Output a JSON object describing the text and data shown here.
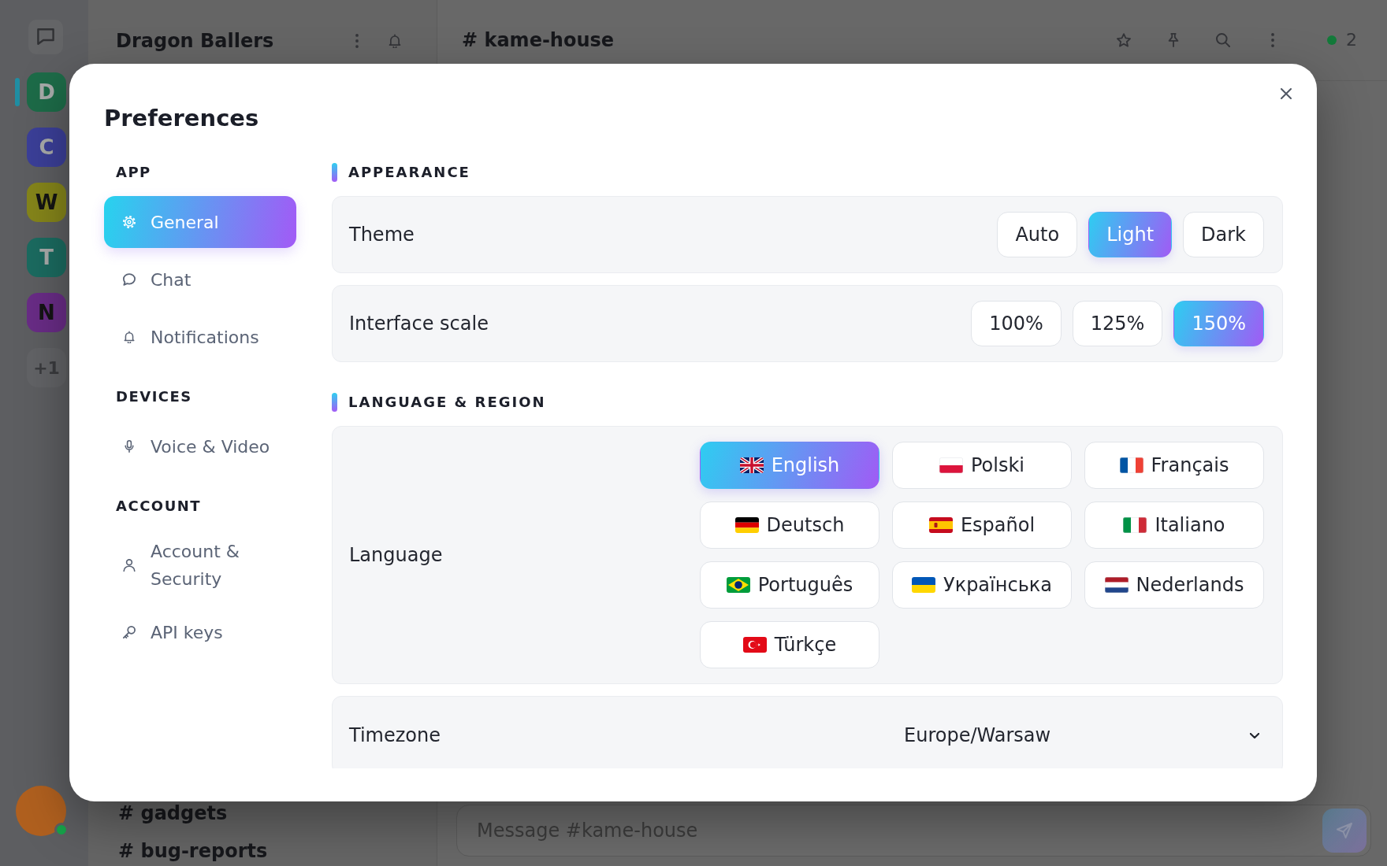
{
  "app": {
    "rail": {
      "servers": [
        {
          "letter": "D",
          "color": "#1d6b48",
          "selected": true
        },
        {
          "letter": "C",
          "color": "#3b3f98",
          "selected": false
        },
        {
          "letter": "W",
          "color": "#85851a",
          "selected": false
        },
        {
          "letter": "T",
          "color": "#1b6b60",
          "selected": false
        },
        {
          "letter": "N",
          "color": "#692c86",
          "selected": false
        }
      ],
      "more": "+1"
    },
    "sidebar": {
      "title": "Dragon Ballers",
      "channels": [
        {
          "label": "# gadgets"
        },
        {
          "label": "# bug-reports"
        }
      ]
    },
    "channel": {
      "title": "# kame-house",
      "online_count": "2",
      "composer": {
        "placeholder": "Message #kame-house"
      }
    }
  },
  "dialog": {
    "title": "Preferences",
    "nav": [
      {
        "heading": "APP",
        "items": [
          {
            "label": "General",
            "selected": true
          },
          {
            "label": "Chat",
            "selected": false
          },
          {
            "label": "Notifications",
            "selected": false
          }
        ]
      },
      {
        "heading": "DEVICES",
        "items": [
          {
            "label": "Voice & Video",
            "selected": false
          }
        ]
      },
      {
        "heading": "ACCOUNT",
        "items": [
          {
            "label": "Account & Security",
            "selected": false
          },
          {
            "label": "API keys",
            "selected": false
          }
        ]
      }
    ],
    "sections": [
      {
        "heading": "APPEARANCE",
        "rows": [
          {
            "kind": "segmented",
            "label": "Theme",
            "options": [
              {
                "label": "Auto",
                "selected": false
              },
              {
                "label": "Light",
                "selected": true
              },
              {
                "label": "Dark",
                "selected": false
              }
            ]
          },
          {
            "kind": "segmented",
            "label": "Interface scale",
            "options": [
              {
                "label": "100%",
                "selected": false
              },
              {
                "label": "125%",
                "selected": false
              },
              {
                "label": "150%",
                "selected": true
              }
            ]
          }
        ]
      },
      {
        "heading": "LANGUAGE & REGION",
        "rows": [
          {
            "kind": "grid",
            "label": "Language",
            "options": [
              {
                "label": "English",
                "selected": true
              },
              {
                "label": "Polski",
                "selected": false
              },
              {
                "label": "Français",
                "selected": false
              },
              {
                "label": "Deutsch",
                "selected": false
              },
              {
                "label": "Español",
                "selected": false
              },
              {
                "label": "Italiano",
                "selected": false
              },
              {
                "label": "Português",
                "selected": false
              },
              {
                "label": "Українська",
                "selected": false
              },
              {
                "label": "Nederlands",
                "selected": false
              },
              {
                "label": "Türkçe",
                "selected": false
              }
            ]
          },
          {
            "kind": "select",
            "label": "Timezone",
            "value": "Europe/Warsaw"
          }
        ]
      }
    ]
  }
}
